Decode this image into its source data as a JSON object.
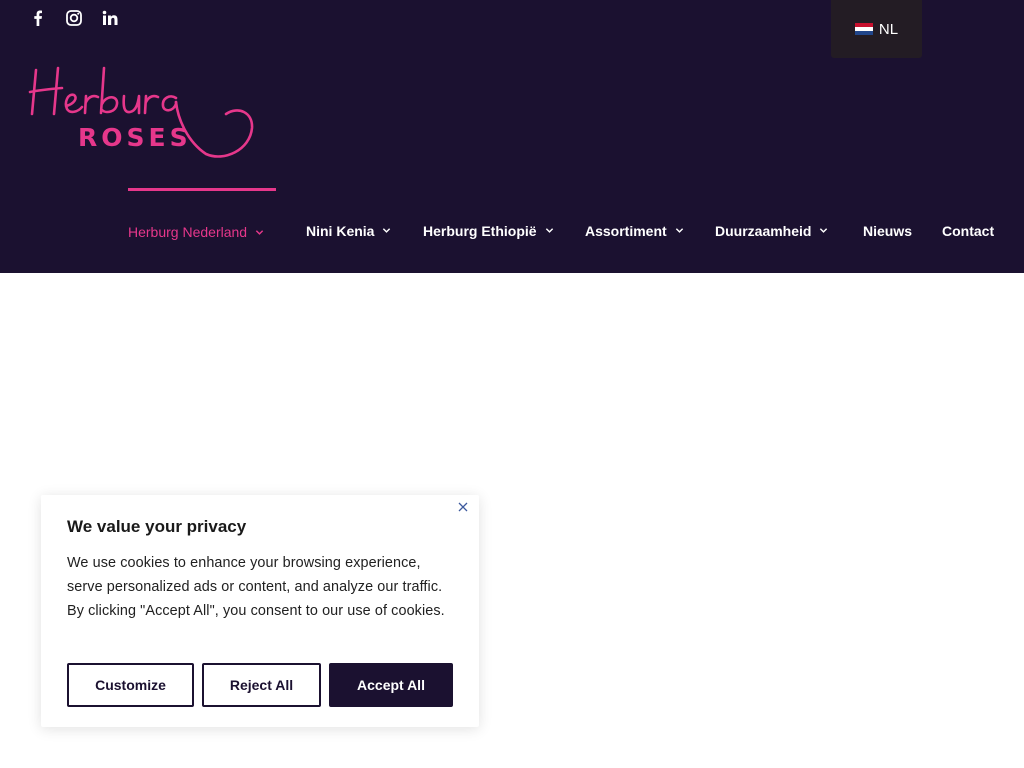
{
  "header": {
    "social": [
      {
        "icon": "facebook-icon"
      },
      {
        "icon": "instagram-icon"
      },
      {
        "icon": "linkedin-icon"
      }
    ],
    "language": {
      "code": "NL",
      "flag": "netherlands-flag-icon"
    },
    "logo": {
      "script_text": "Herburg",
      "sub_text": "ROSES"
    },
    "colors": {
      "background": "#1b1130",
      "accent": "#e6378b"
    }
  },
  "nav": {
    "items": [
      {
        "label": "Herburg Nederland",
        "has_dropdown": true,
        "active": true
      },
      {
        "label": "Nini Kenia",
        "has_dropdown": true,
        "active": false
      },
      {
        "label": "Herburg Ethiopië",
        "has_dropdown": true,
        "active": false
      },
      {
        "label": "Assortiment",
        "has_dropdown": true,
        "active": false
      },
      {
        "label": "Duurzaamheid",
        "has_dropdown": true,
        "active": false
      },
      {
        "label": "Nieuws",
        "has_dropdown": false,
        "active": false
      },
      {
        "label": "Contact",
        "has_dropdown": false,
        "active": false
      }
    ]
  },
  "cookie": {
    "title": "We value your privacy",
    "text": "We use cookies to enhance your browsing experience, serve personalized ads or content, and analyze our traffic. By clicking \"Accept All\", you consent to our use of cookies.",
    "buttons": {
      "customize": "Customize",
      "reject": "Reject All",
      "accept": "Accept All"
    }
  }
}
